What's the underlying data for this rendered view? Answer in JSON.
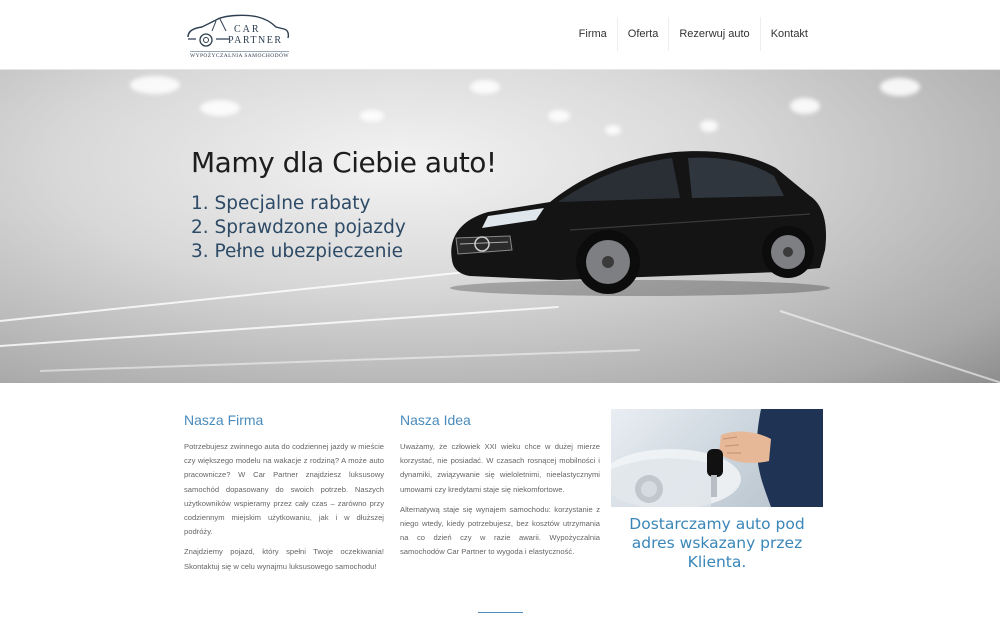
{
  "logo": {
    "line1": "CAR",
    "line2": "PARTNER",
    "subtitle": "WYPOŻYCZALNIA SAMOCHODÓW"
  },
  "nav": {
    "items": [
      "Firma",
      "Oferta",
      "Rezerwuj auto",
      "Kontakt"
    ]
  },
  "hero": {
    "title": "Mamy dla Ciebie auto!",
    "points": [
      "1. Specjalne rabaty",
      "2. Sprawdzone pojazdy",
      "3. Pełne ubezpieczenie"
    ]
  },
  "firma": {
    "title": "Nasza Firma",
    "p1": "Potrzebujesz zwinnego auta do codziennej jazdy w mieście czy większego modelu na wakacje z rodziną? A może auto pracownicze? W Car Partner znajdziesz luksusowy samochód dopasowany do swoich potrzeb. Naszych użytkowników wspieramy przez cały czas – zarówno przy codziennym miejskim użytkowaniu, jak i w dłuższej podróży.",
    "p2": "Znajdziemy pojazd, który spełni Twoje oczekiwania! Skontaktuj się w celu wynajmu luksusowego samochodu!"
  },
  "idea": {
    "title": "Nasza Idea",
    "p1": "Uważamy, że człowiek XXI wieku chce w dużej mierze korzystać, nie posiadać. W czasach rosnącej mobilności i dynamiki, związywanie się wieloletnimi, nieelastycznymi umowami czy kredytami staje się niekomfortowe.",
    "p2": "Alternatywą staje się wynajem samochodu: korzystanie z niego wtedy, kiedy potrzebujesz, bez kosztów utrzymania na co dzień czy w razie awarii. Wypożyczalnia samochodów Car Partner to wygoda i elastyczność."
  },
  "promo": {
    "tagline": "Dostarczamy auto pod adres wskazany przez Klienta."
  },
  "colors": {
    "accent": "#4a8bbd",
    "hero_text": "#2d4a66",
    "tagline": "#3a86b8"
  }
}
